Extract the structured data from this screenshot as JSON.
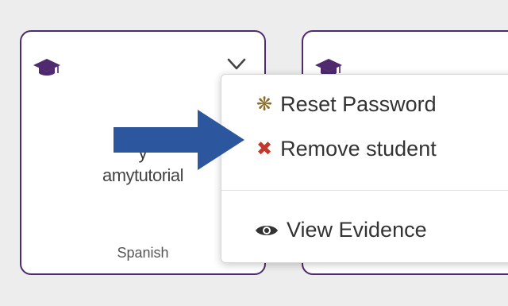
{
  "cards": [
    {
      "icon": "graduation-cap-icon",
      "name": "y",
      "username": "amytutorial",
      "language": "Spanish"
    },
    {
      "icon": "graduation-cap-icon"
    }
  ],
  "menu": {
    "items": [
      {
        "label": "Reset Password",
        "icon": "asterisk-icon",
        "icon_color": "#8a6d2a"
      },
      {
        "label": "Remove student",
        "icon": "x-icon",
        "icon_color": "#c0392b"
      },
      {
        "label": "View Evidence",
        "icon": "eye-icon",
        "icon_color": "#333333"
      }
    ]
  },
  "colors": {
    "card_border": "#4f2a6e",
    "arrow": "#2c569e",
    "cap_icon": "#4f2a6e"
  }
}
